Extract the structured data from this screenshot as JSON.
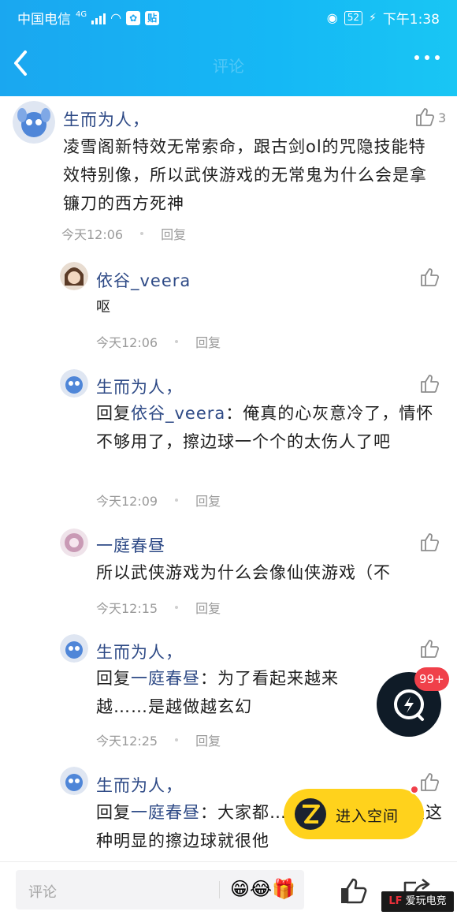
{
  "status_bar": {
    "carrier": "中国电信",
    "network": "4G",
    "app_badge": "贴",
    "battery": "52",
    "time": "下午1:38"
  },
  "nav": {
    "title": "评论"
  },
  "colors": {
    "header": "#1aa7f0",
    "name": "#2e4a86",
    "meta": "#9a9a9a",
    "badge": "#f0404a",
    "space_button": "#ffd21c"
  },
  "main_comment": {
    "user": "生而为人，",
    "text": "凌雪阁新特效无常索命，跟古剑ol的咒隐技能特效特别像，所以武侠游戏的无常鬼为什么会是拿镰刀的西方死神",
    "time": "今天12:06",
    "reply_label": "回复",
    "likes": "3"
  },
  "replies": [
    {
      "user": "依谷_veera",
      "text": "呕",
      "time": "今天12:06",
      "reply_label": "回复"
    },
    {
      "user": "生而为人，",
      "prefix": "回复",
      "mention": "依谷_veera",
      "text": "：俺真的心灰意冷了，情怀不够用了，擦边球一个个的太伤人了吧",
      "time": "今天12:09",
      "reply_label": "回复"
    },
    {
      "user": "一庭春昼",
      "text": "所以武侠游戏为什么会像仙侠游戏（不",
      "time": "今天12:15",
      "reply_label": "回复"
    },
    {
      "user": "生而为人，",
      "prefix": "回复",
      "mention": "一庭春昼",
      "text": "：为了看起来越来越……是越做越玄幻",
      "time": "今天12:25",
      "reply_label": "回复"
    },
    {
      "user": "生而为人，",
      "prefix": "回复",
      "mention": "一庭春昼",
      "text": "：大家都……的很正常，但是这种明显的擦边球就很他",
      "time": "",
      "reply_label": ""
    }
  ],
  "floating": {
    "badge": "99+",
    "space_button": "进入空间"
  },
  "bottom_bar": {
    "placeholder": "评论",
    "emojis": "😁😂🎁"
  },
  "watermark": {
    "brand": "LF",
    "text": "爱玩电竞"
  }
}
